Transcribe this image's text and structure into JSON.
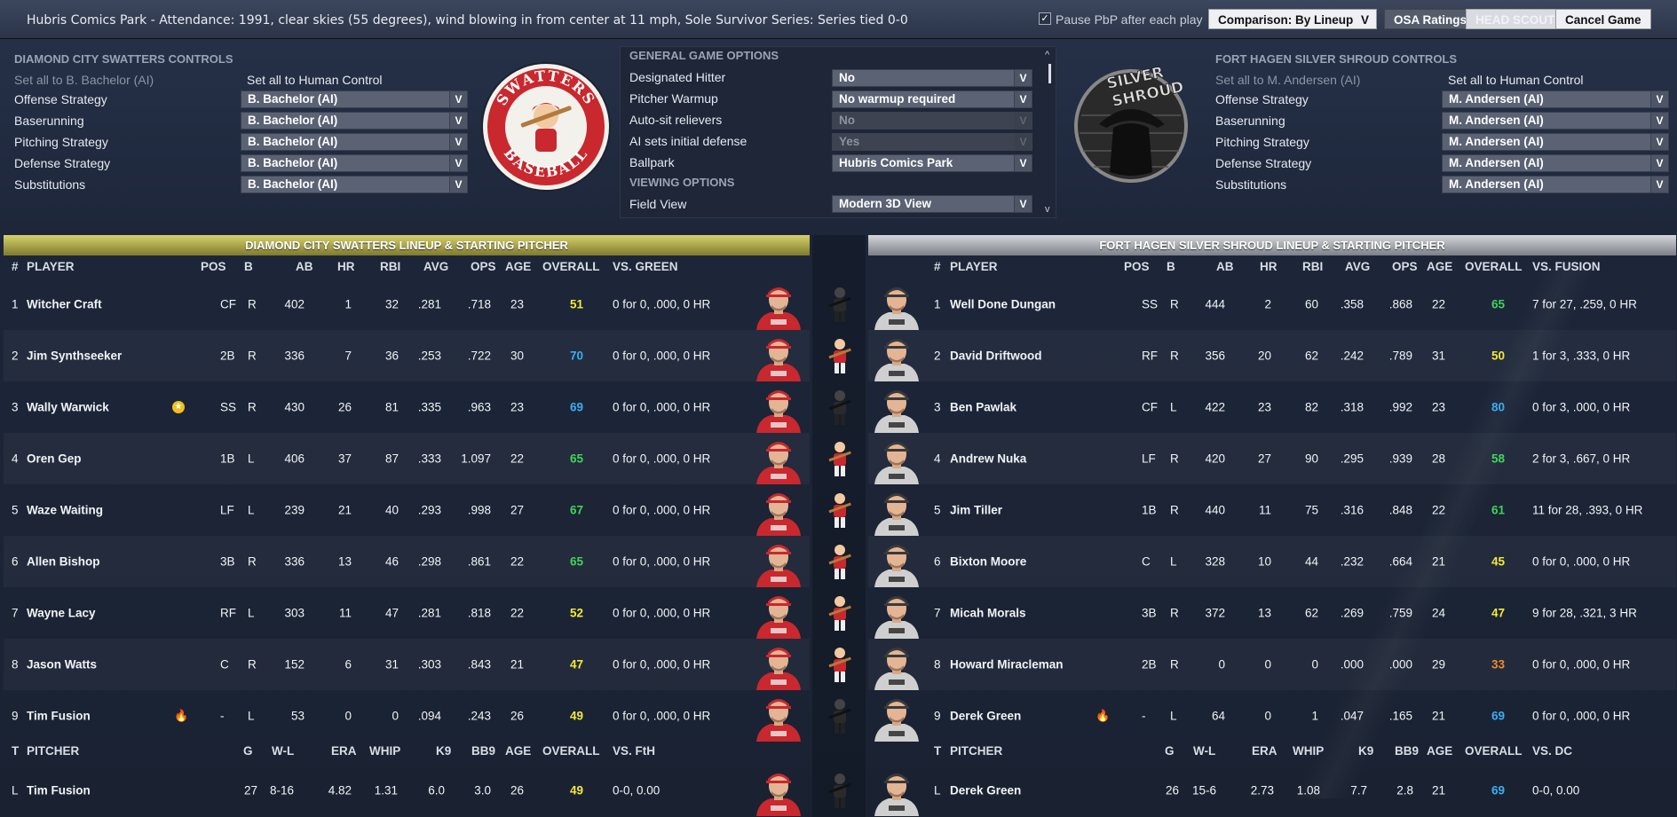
{
  "topbar": {
    "title": "Hubris Comics Park - Attendance: 1991, clear skies (55  degrees), wind blowing in from center at 11 mph, Sole Survivor Series: Series tied 0-0",
    "pause_label": "Pause PbP after each play",
    "pause_checked": "✓",
    "comparison_label": "Comparison: By Lineup",
    "osa_label": "OSA Ratings",
    "head_scout_label": "HEAD SCOUT",
    "cancel_label": "Cancel Game"
  },
  "home_controls": {
    "title": "DIAMOND CITY SWATTERS CONTROLS",
    "set_all_ai": "Set all to B. Bachelor (AI)",
    "set_all_human": "Set all to Human Control",
    "rows": [
      {
        "label": "Offense Strategy",
        "value": "B. Bachelor (AI)"
      },
      {
        "label": "Baserunning",
        "value": "B. Bachelor (AI)"
      },
      {
        "label": "Pitching Strategy",
        "value": "B. Bachelor (AI)"
      },
      {
        "label": "Defense Strategy",
        "value": "B. Bachelor (AI)"
      },
      {
        "label": "Substitutions",
        "value": "B. Bachelor (AI)"
      }
    ]
  },
  "away_controls": {
    "title": "FORT HAGEN SILVER SHROUD CONTROLS",
    "set_all_ai": "Set all to M. Andersen (AI)",
    "set_all_human": "Set all to Human Control",
    "rows": [
      {
        "label": "Offense Strategy",
        "value": "M. Andersen (AI)"
      },
      {
        "label": "Baserunning",
        "value": "M. Andersen (AI)"
      },
      {
        "label": "Pitching Strategy",
        "value": "M. Andersen (AI)"
      },
      {
        "label": "Defense Strategy",
        "value": "M. Andersen (AI)"
      },
      {
        "label": "Substitutions",
        "value": "M. Andersen (AI)"
      }
    ]
  },
  "logos": {
    "swatters_top": "SWATTERS",
    "swatters_bottom": "BASEBALL",
    "shroud_top": "SILVER",
    "shroud_bottom": "SHROUD"
  },
  "options": {
    "general_title": "GENERAL GAME OPTIONS",
    "viewing_title": "VIEWING OPTIONS",
    "rows": [
      {
        "label": "Designated Hitter",
        "value": "No"
      },
      {
        "label": "Pitcher Warmup",
        "value": "No warmup required"
      },
      {
        "label": "Auto-sit relievers",
        "value": "No"
      },
      {
        "label": "AI sets initial defense",
        "value": "Yes"
      },
      {
        "label": "Ballpark",
        "value": "Hubris Comics Park"
      }
    ],
    "field_view": {
      "label": "Field View",
      "value": "Modern 3D View"
    }
  },
  "home_lineup": {
    "title": "DIAMOND CITY SWATTERS LINEUP & STARTING PITCHER",
    "headers": [
      "#",
      "PLAYER",
      "POS",
      "B",
      "AB",
      "HR",
      "RBI",
      "AVG",
      "OPS",
      "AGE",
      "OVERALL",
      "VS. GREEN"
    ],
    "players": [
      {
        "n": "1",
        "name": "Witcher Craft",
        "pos": "CF",
        "b": "R",
        "ab": "402",
        "hr": "1",
        "rbi": "32",
        "avg": ".281",
        "ops": ".718",
        "age": "23",
        "ovr": "51",
        "ovr_color": "yellow",
        "vs": "0 for 0, .000, 0 HR",
        "badge": ""
      },
      {
        "n": "2",
        "name": "Jim Synthseeker",
        "pos": "2B",
        "b": "R",
        "ab": "336",
        "hr": "7",
        "rbi": "36",
        "avg": ".253",
        "ops": ".722",
        "age": "30",
        "ovr": "70",
        "ovr_color": "blue",
        "vs": "0 for 0, .000, 0 HR",
        "badge": ""
      },
      {
        "n": "3",
        "name": "Wally Warwick",
        "pos": "SS",
        "b": "R",
        "ab": "430",
        "hr": "26",
        "rbi": "81",
        "avg": ".335",
        "ops": ".963",
        "age": "23",
        "ovr": "69",
        "ovr_color": "blue",
        "vs": "0 for 0, .000, 0 HR",
        "badge": "star"
      },
      {
        "n": "4",
        "name": "Oren Gep",
        "pos": "1B",
        "b": "L",
        "ab": "406",
        "hr": "37",
        "rbi": "87",
        "avg": ".333",
        "ops": "1.097",
        "age": "22",
        "ovr": "65",
        "ovr_color": "green",
        "vs": "0 for 0, .000, 0 HR",
        "badge": ""
      },
      {
        "n": "5",
        "name": "Waze Waiting",
        "pos": "LF",
        "b": "L",
        "ab": "239",
        "hr": "21",
        "rbi": "40",
        "avg": ".293",
        "ops": ".998",
        "age": "27",
        "ovr": "67",
        "ovr_color": "green",
        "vs": "0 for 0, .000, 0 HR",
        "badge": ""
      },
      {
        "n": "6",
        "name": "Allen Bishop",
        "pos": "3B",
        "b": "R",
        "ab": "336",
        "hr": "13",
        "rbi": "46",
        "avg": ".298",
        "ops": ".861",
        "age": "22",
        "ovr": "65",
        "ovr_color": "green",
        "vs": "0 for 0, .000, 0 HR",
        "badge": ""
      },
      {
        "n": "7",
        "name": "Wayne Lacy",
        "pos": "RF",
        "b": "L",
        "ab": "303",
        "hr": "11",
        "rbi": "47",
        "avg": ".281",
        "ops": ".818",
        "age": "22",
        "ovr": "52",
        "ovr_color": "yellow",
        "vs": "0 for 0, .000, 0 HR",
        "badge": ""
      },
      {
        "n": "8",
        "name": "Jason Watts",
        "pos": "C",
        "b": "R",
        "ab": "152",
        "hr": "6",
        "rbi": "31",
        "avg": ".303",
        "ops": ".843",
        "age": "21",
        "ovr": "47",
        "ovr_color": "yellow",
        "vs": "0 for 0, .000, 0 HR",
        "badge": ""
      },
      {
        "n": "9",
        "name": "Tim Fusion",
        "pos": "-",
        "b": "L",
        "ab": "53",
        "hr": "0",
        "rbi": "0",
        "avg": ".094",
        "ops": ".243",
        "age": "26",
        "ovr": "49",
        "ovr_color": "yellow",
        "vs": "0 for 0, .000, 0 HR",
        "badge": "fire"
      }
    ],
    "pitcher_headers": [
      "T",
      "PITCHER",
      "G",
      "W-L",
      "ERA",
      "WHIP",
      "K9",
      "BB9",
      "AGE",
      "OVERALL",
      "VS. FtH"
    ],
    "pitcher": {
      "t": "L",
      "name": "Tim Fusion",
      "g": "27",
      "wl": "8-16",
      "era": "4.82",
      "whip": "1.31",
      "k9": "6.0",
      "bb9": "3.0",
      "age": "26",
      "ovr": "49",
      "vs": "0-0, 0.00"
    }
  },
  "away_lineup": {
    "title": "FORT HAGEN SILVER SHROUD LINEUP & STARTING PITCHER",
    "headers": [
      "#",
      "PLAYER",
      "POS",
      "B",
      "AB",
      "HR",
      "RBI",
      "AVG",
      "OPS",
      "AGE",
      "OVERALL",
      "VS. FUSION"
    ],
    "players": [
      {
        "n": "1",
        "name": "Well Done Dungan",
        "pos": "SS",
        "b": "R",
        "ab": "444",
        "hr": "2",
        "rbi": "60",
        "avg": ".358",
        "ops": ".868",
        "age": "22",
        "ovr": "65",
        "ovr_color": "green",
        "vs": "7 for 27, .259, 0 HR",
        "badge": ""
      },
      {
        "n": "2",
        "name": "David Driftwood",
        "pos": "RF",
        "b": "R",
        "ab": "356",
        "hr": "20",
        "rbi": "62",
        "avg": ".242",
        "ops": ".789",
        "age": "31",
        "ovr": "50",
        "ovr_color": "yellow",
        "vs": "1 for 3, .333, 0 HR",
        "badge": ""
      },
      {
        "n": "3",
        "name": "Ben Pawlak",
        "pos": "CF",
        "b": "L",
        "ab": "422",
        "hr": "23",
        "rbi": "82",
        "avg": ".318",
        "ops": ".992",
        "age": "23",
        "ovr": "80",
        "ovr_color": "blue",
        "vs": "0 for 3, .000, 0 HR",
        "badge": ""
      },
      {
        "n": "4",
        "name": "Andrew Nuka",
        "pos": "LF",
        "b": "R",
        "ab": "420",
        "hr": "27",
        "rbi": "90",
        "avg": ".295",
        "ops": ".939",
        "age": "28",
        "ovr": "58",
        "ovr_color": "green",
        "vs": "2 for 3, .667, 0 HR",
        "badge": ""
      },
      {
        "n": "5",
        "name": "Jim Tiller",
        "pos": "1B",
        "b": "R",
        "ab": "440",
        "hr": "11",
        "rbi": "75",
        "avg": ".316",
        "ops": ".848",
        "age": "22",
        "ovr": "61",
        "ovr_color": "green",
        "vs": "11 for 28, .393, 0 HR",
        "badge": ""
      },
      {
        "n": "6",
        "name": "Bixton Moore",
        "pos": "C",
        "b": "L",
        "ab": "328",
        "hr": "10",
        "rbi": "44",
        "avg": ".232",
        "ops": ".664",
        "age": "21",
        "ovr": "45",
        "ovr_color": "yellow",
        "vs": "0 for 0, .000, 0 HR",
        "badge": ""
      },
      {
        "n": "7",
        "name": "Micah Morals",
        "pos": "3B",
        "b": "R",
        "ab": "372",
        "hr": "13",
        "rbi": "62",
        "avg": ".269",
        "ops": ".759",
        "age": "24",
        "ovr": "47",
        "ovr_color": "yellow",
        "vs": "9 for 28, .321, 3 HR",
        "badge": ""
      },
      {
        "n": "8",
        "name": "Howard Miracleman",
        "pos": "2B",
        "b": "R",
        "ab": "0",
        "hr": "0",
        "rbi": "0",
        "avg": ".000",
        "ops": ".000",
        "age": "29",
        "ovr": "33",
        "ovr_color": "orange",
        "vs": "0 for 0, .000, 0 HR",
        "badge": ""
      },
      {
        "n": "9",
        "name": "Derek Green",
        "pos": "-",
        "b": "L",
        "ab": "64",
        "hr": "0",
        "rbi": "1",
        "avg": ".047",
        "ops": ".165",
        "age": "21",
        "ovr": "69",
        "ovr_color": "blue",
        "vs": "0 for 0, .000, 0 HR",
        "badge": "fire"
      }
    ],
    "pitcher_headers": [
      "T",
      "PITCHER",
      "G",
      "W-L",
      "ERA",
      "WHIP",
      "K9",
      "BB9",
      "AGE",
      "OVERALL",
      "VS. DC"
    ],
    "pitcher": {
      "t": "L",
      "name": "Derek Green",
      "g": "26",
      "wl": "15-6",
      "era": "2.73",
      "whip": "1.08",
      "k9": "7.7",
      "bb9": "2.8",
      "age": "21",
      "ovr": "69",
      "vs": "0-0, 0.00"
    }
  },
  "colors": {
    "green": "#3fd45a",
    "yellow": "#f2ea3a",
    "blue": "#38aef0",
    "orange": "#f08a2a",
    "swatters_red": "#c8282e",
    "gold_header": "#b9b44f"
  }
}
